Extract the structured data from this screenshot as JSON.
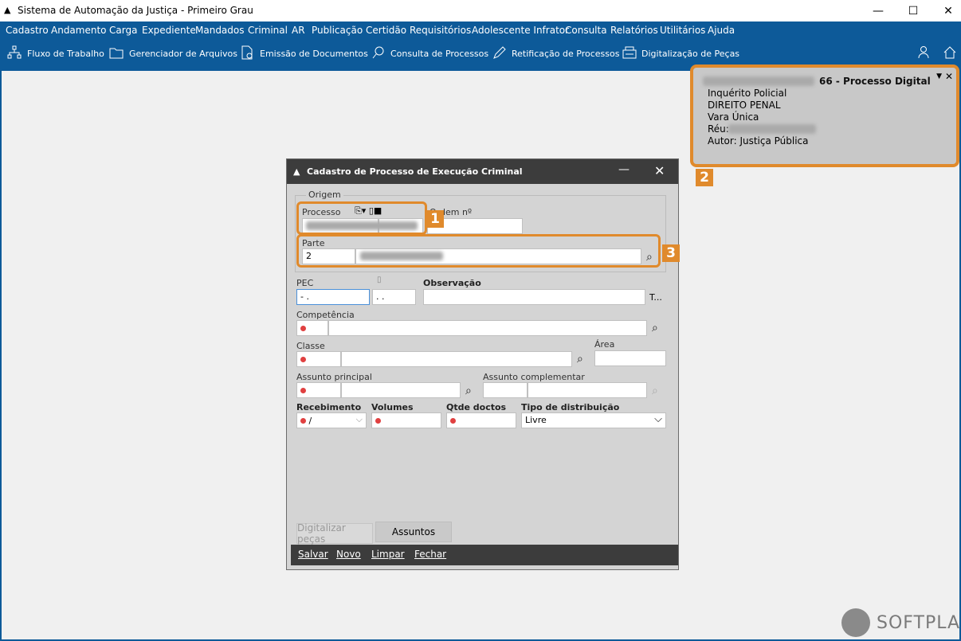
{
  "window": {
    "title": "Sistema de Automação da Justiça - Primeiro Grau"
  },
  "menu": [
    "Cadastro",
    "Andamento",
    "Carga",
    "Expediente",
    "Mandados",
    "Criminal",
    "AR",
    "Publicação",
    "Certidão",
    "Requisitórios",
    "Adolescente Infrator",
    "Consulta",
    "Relatórios",
    "Utilitários",
    "Ajuda"
  ],
  "toolbar": [
    "Fluxo de Trabalho",
    "Gerenciador de Arquivos",
    "Emissão de Documentos",
    "Consulta de Processos",
    "Retificação de Processos",
    "Digitalização de Peças"
  ],
  "panel": {
    "header_suffix": "66 - Processo Digital",
    "line1": "Inquérito Policial",
    "line2": "DIREITO PENAL",
    "line3": "Vara Única",
    "reu_label": "Réu:",
    "autor": "Autor: Justiça Pública",
    "badge": "2"
  },
  "dialog": {
    "title": "Cadastro de Processo de Execução Criminal",
    "origem": "Origem",
    "processo_label": "Processo",
    "ordem_label": "Ordem nº",
    "parte_label": "Parte",
    "parte_value": "2",
    "pec_label": "PEC",
    "pec_value": "- .",
    "pec_suffix": ". .",
    "obs_label": "Observação",
    "obs_button": "T...",
    "competencia_label": "Competência",
    "classe_label": "Classe",
    "area_label": "Área",
    "assunto_principal_label": "Assunto principal",
    "assunto_complementar_label": "Assunto complementar",
    "recebimento_label": "Recebimento",
    "recebimento_value": "/",
    "volumes_label": "Volumes",
    "qtde_label": "Qtde doctos",
    "tipo_label": "Tipo de distribuição",
    "tipo_value": "Livre",
    "btn_digitalizar": "Digitalizar peças",
    "btn_assuntos": "Assuntos",
    "salvar": "Salvar",
    "novo": "Novo",
    "limpar": "Limpar",
    "fechar": "Fechar",
    "badge1": "1",
    "badge3": "3"
  },
  "brand": "SOFTPLAN"
}
